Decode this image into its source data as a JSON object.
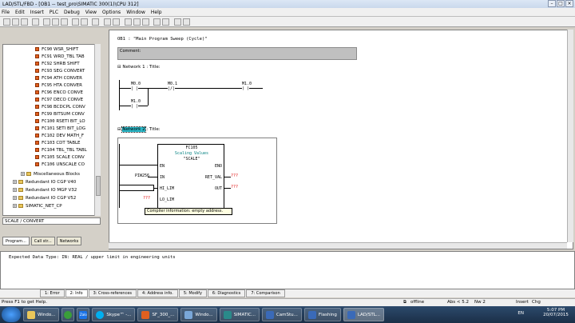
{
  "window": {
    "title": "LAD/STL/FBD - [OB1 -- test_pro\\SIMATIC 300(1)\\CPU 312]"
  },
  "menu": [
    "File",
    "Edit",
    "Insert",
    "PLC",
    "Debug",
    "View",
    "Options",
    "Window",
    "Help"
  ],
  "tree": {
    "items": [
      {
        "code": "FC90",
        "name": "WSR_SHIFT"
      },
      {
        "code": "FC91",
        "name": "WRD_TBL TAB"
      },
      {
        "code": "FC92",
        "name": "SHRB SHIFT"
      },
      {
        "code": "FC93",
        "name": "SEG CONVERT"
      },
      {
        "code": "FC94",
        "name": "ATH CONVER"
      },
      {
        "code": "FC95",
        "name": "HTA CONVER"
      },
      {
        "code": "FC96",
        "name": "ENCO CONVE"
      },
      {
        "code": "FC97",
        "name": "DECO CONVE"
      },
      {
        "code": "FC98",
        "name": "BCDCPL CONV"
      },
      {
        "code": "FC99",
        "name": "BITSUM CONV"
      },
      {
        "code": "FC100",
        "name": "RSETI BIT_LO"
      },
      {
        "code": "FC101",
        "name": "SETI BIT_LOG"
      },
      {
        "code": "FC102",
        "name": "DEV MATH_F"
      },
      {
        "code": "FC103",
        "name": "CDT TABLE"
      },
      {
        "code": "FC104",
        "name": "TBL_TBL TABL"
      },
      {
        "code": "FC105",
        "name": "SCALE CONV"
      },
      {
        "code": "FC106",
        "name": "UNSCALE CO"
      }
    ],
    "folders": [
      "Miscellaneous Blocks",
      "Redundant IO CGP V40",
      "Redundant IO MGP V32",
      "Redundant IO CGP V52",
      "SIMATIC_NET_CP"
    ],
    "status": "SCALE / CONVERT"
  },
  "left_tabs": [
    "Program...",
    "Call str...",
    "Networks"
  ],
  "editor": {
    "ob_title": "OB1 :   \"Main Program Sweep (Cycle)\"",
    "comment_label": "Comment:",
    "network1": {
      "label": "Network 1",
      "title": ": Title:",
      "contacts": [
        "M0.0",
        "M0.1",
        "M1.0",
        "M1.0"
      ]
    },
    "network2": {
      "label": "Network 2",
      "title": ": Title:"
    },
    "block": {
      "name": "FC105",
      "desc": "Scaling Values",
      "symbol": "\"SCALE\"",
      "pins_left": [
        "EN",
        "IN",
        "HI_LIM",
        "LO_LIM"
      ],
      "pins_right": [
        "ENO",
        "RET_VAL",
        "OUT"
      ],
      "in_value": "PIW256",
      "unassigned": "???"
    },
    "tooltip": "Compiler information: empty address."
  },
  "output": {
    "text": "Expected Data Type: IN: REAL /  upper limit in engineering units"
  },
  "output_tabs": [
    "1: Error",
    "2: Info",
    "3: Cross-references",
    "4: Address info.",
    "5: Modify",
    "6: Diagnostics",
    "7: Comparison"
  ],
  "status": {
    "help": "Press F1 to get Help.",
    "mode": "offline",
    "abs": "Abs < 5.2",
    "nw": "Nw 2",
    "insert": "Insert",
    "chg": "Chg"
  },
  "taskbar": {
    "items": [
      "Windo...",
      "Zalo",
      "Skype™ -...",
      "SF_300_...",
      "Windo...",
      "SIMATIC...",
      "CamStu...",
      "Flashing",
      "LAD/STL..."
    ],
    "lang": "EN",
    "time": "5:07 PM",
    "date": "20/07/2015"
  },
  "colors": {
    "highlight": "#2bb8c8",
    "title_bar": "#dce7f5",
    "fc_icon": "#e06020",
    "taskbar": "#1b2f47"
  }
}
